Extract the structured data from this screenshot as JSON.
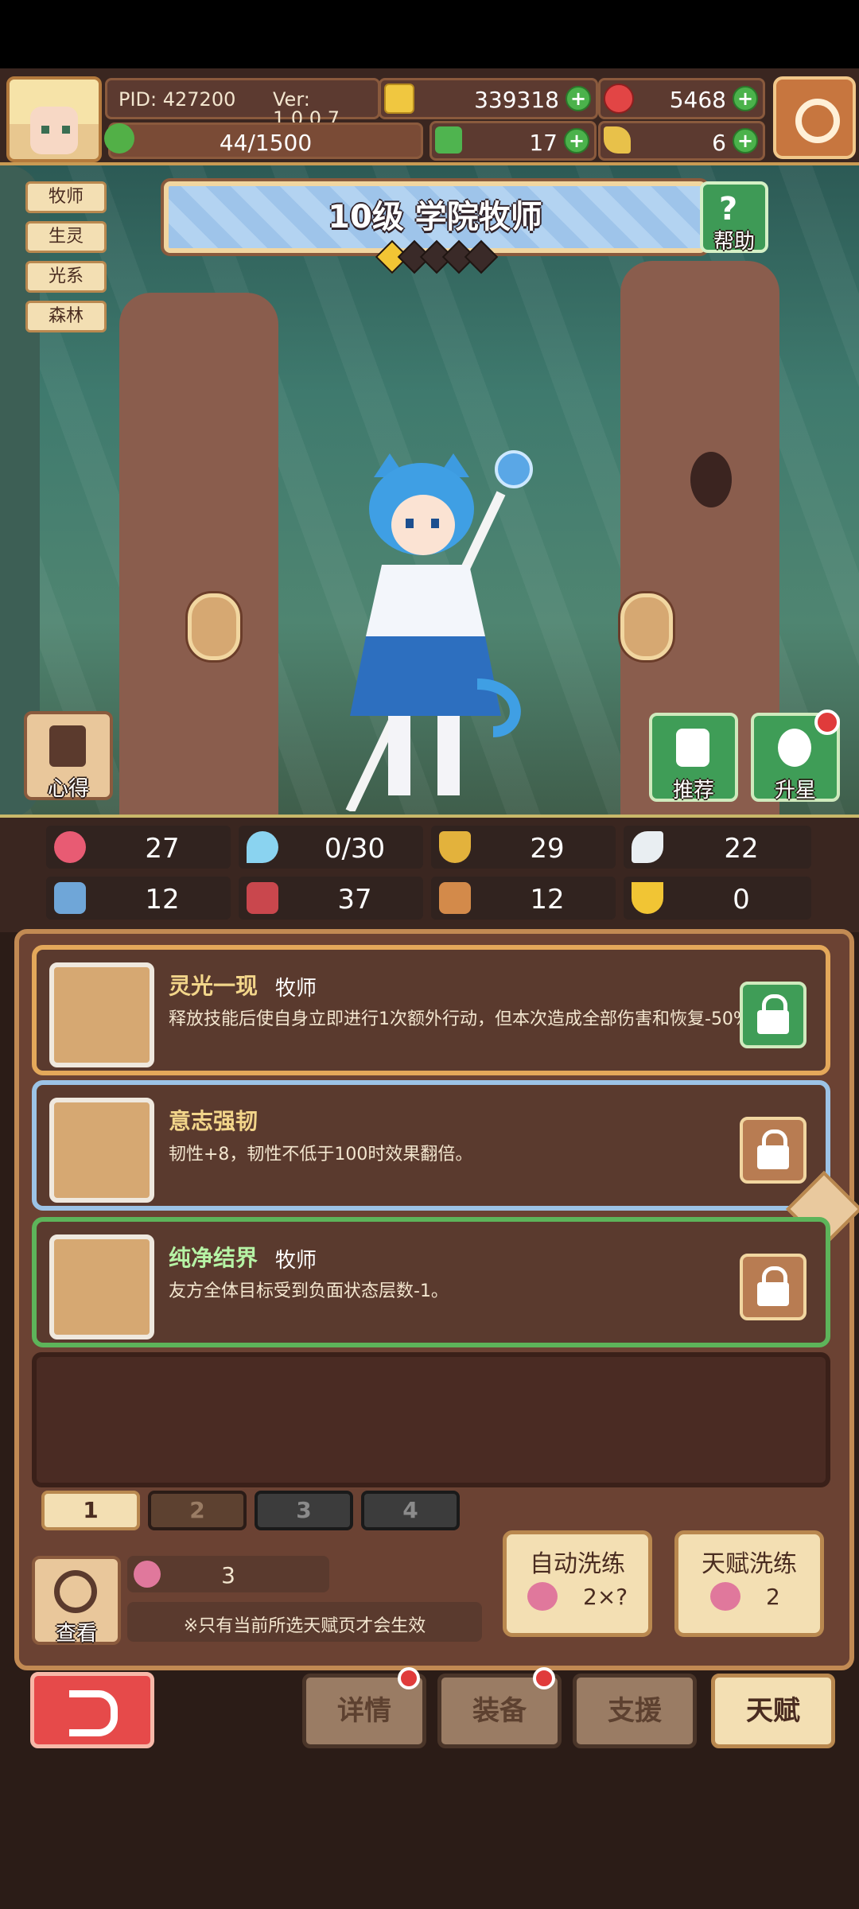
{
  "header": {
    "pid": "PID: 427200",
    "version": "Ver: 1.0.0.7",
    "gold": "339318",
    "gems": "5468",
    "energy": "44/1500",
    "clover": "17",
    "horn": "6"
  },
  "tags": [
    "牧师",
    "生灵",
    "光系",
    "森林"
  ],
  "hero": {
    "title": "10级 学院牧师",
    "stars_filled": 1,
    "stars_total": 5
  },
  "buttons": {
    "help": "帮助",
    "insight": "心得",
    "recommend": "推荐",
    "star_up": "升星",
    "view": "查看",
    "auto_refine": "自动洗练",
    "auto_refine_cost": "2×?",
    "talent_refine": "天赋洗练",
    "talent_refine_cost": "2"
  },
  "stats": {
    "row1": [
      "27",
      "0/30",
      "29",
      "22"
    ],
    "row2": [
      "12",
      "37",
      "12",
      "0"
    ]
  },
  "talents": [
    {
      "name": "灵光一现",
      "class": "牧师",
      "desc": "释放技能后使自身立即进行1次额外行动，但本次造成全部伤害和恢复-50%。",
      "border": "#e4a85a",
      "lock_color": "#3f9d57"
    },
    {
      "name": "意志强韧",
      "class": "",
      "desc": "韧性+8，韧性不低于100时效果翻倍。",
      "border": "#9cc3e6",
      "lock_color": "#b87c52"
    },
    {
      "name": "纯净结界",
      "class": "牧师",
      "desc": "友方全体目标受到负面状态层数-1。",
      "border": "#5db45a",
      "lock_color": "#b87c52"
    }
  ],
  "pages": [
    "1",
    "2",
    "3",
    "4"
  ],
  "refine": {
    "count": "3",
    "note": "※只有当前所选天赋页才会生效"
  },
  "bottom_tabs": [
    "详情",
    "装备",
    "支援",
    "天赋"
  ]
}
